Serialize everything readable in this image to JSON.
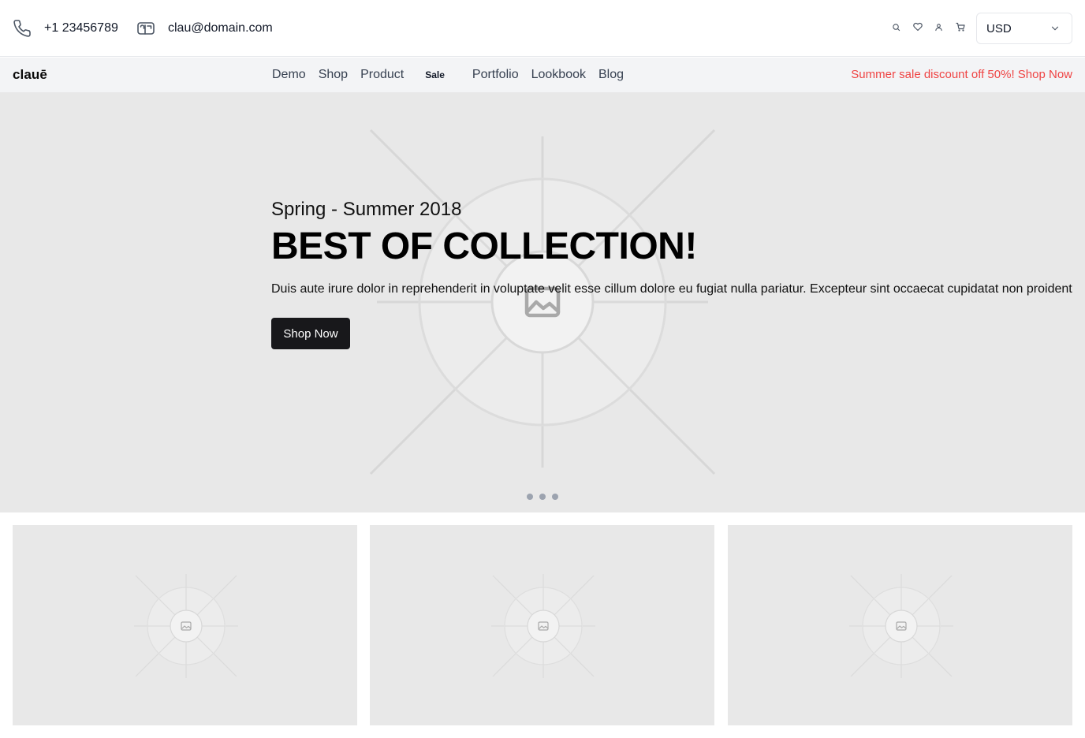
{
  "topbar": {
    "phone": "+1 23456789",
    "email": "clau@domain.com",
    "icons": [
      "phone-icon",
      "mail-icon",
      "search-icon",
      "heart-icon",
      "user-icon",
      "cart-icon",
      "chevron-down-icon"
    ],
    "currency": "USD"
  },
  "nav": {
    "brand": "clauē",
    "links": [
      "Demo",
      "Shop",
      "Product",
      "Sale",
      "Portfolio",
      "Lookbook",
      "Blog"
    ],
    "promo": "Summer sale discount off 50%! Shop Now"
  },
  "hero": {
    "subtitle": "Spring - Summer 2018",
    "title": "BEST OF COLLECTION!",
    "description": "Duis aute irure dolor in reprehenderit in voluptate velit esse cillum dolore eu fugiat nulla pariatur. Excepteur sint occaecat cupidatat non proident",
    "cta": "Shop Now",
    "slides": 3
  },
  "cards": [
    {
      "icon": "image-placeholder-icon"
    },
    {
      "icon": "image-placeholder-icon"
    },
    {
      "icon": "image-placeholder-icon"
    }
  ],
  "colors": {
    "promo": "#ef4444",
    "cta_bg": "#18181b",
    "nav_bg": "#f3f4f6",
    "placeholder_bg": "#e8e8e8"
  }
}
